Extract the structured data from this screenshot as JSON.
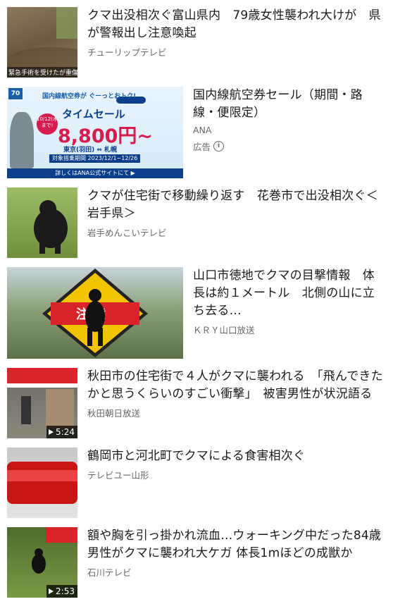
{
  "items": [
    {
      "title": "クマ出没相次ぐ富山県内　79歳女性襲われ大けが　県が警報出し注意喚起",
      "source": "チューリップテレビ",
      "thumb_caption": "緊急手術を受けたが重傷",
      "thumb_colors": [
        "#7a6a52",
        "#a89474"
      ]
    },
    {
      "title": "国内線航空券セール（期間・路線・便限定）",
      "source": "ANA",
      "ad_label": "広告",
      "ad": {
        "badge": "70",
        "top_text": "国内線航空券が ぐーっとおトク!",
        "date": "10/12(木)まで!",
        "sale": "タイムセール",
        "price": "8,800円~",
        "route": "東京(羽田) ⇔ 札幌",
        "period": "対象搭乗期間 2023/12/1~12/26",
        "bottom": "詳しくはANA公式サイトにて ▶",
        "brand_color": "#0b3f8c"
      }
    },
    {
      "title": "クマが住宅街で移動繰り返す　花巻市で出没相次ぐ＜岩手県＞",
      "source": "岩手めんこいテレビ",
      "thumb_colors": [
        "#8fae5a",
        "#5d7a36"
      ]
    },
    {
      "title": "山口市徳地でクマの目撃情報　体長は約１メートル　北側の山に立ち去る…",
      "source": "ＫＲＹ山口放送",
      "sign_text": "注 意",
      "sign_color": "#f2c400"
    },
    {
      "title": "秋田市の住宅街で４人がクマに襲われる　「飛んできたかと思うくらいのすごい衝撃」　被害男性が状況語る",
      "source": "秋田朝日放送",
      "duration": "5:24"
    },
    {
      "title": "鶴岡市と河北町でクマによる食害相次ぐ",
      "source": "テレビユー山形"
    },
    {
      "title": "額や胸を引っ掛かれ流血…ウォーキング中だった84歳男性がクマに襲われ大ケガ 体長1mほどの成獣か",
      "source": "石川テレビ",
      "duration": "2:53"
    }
  ]
}
